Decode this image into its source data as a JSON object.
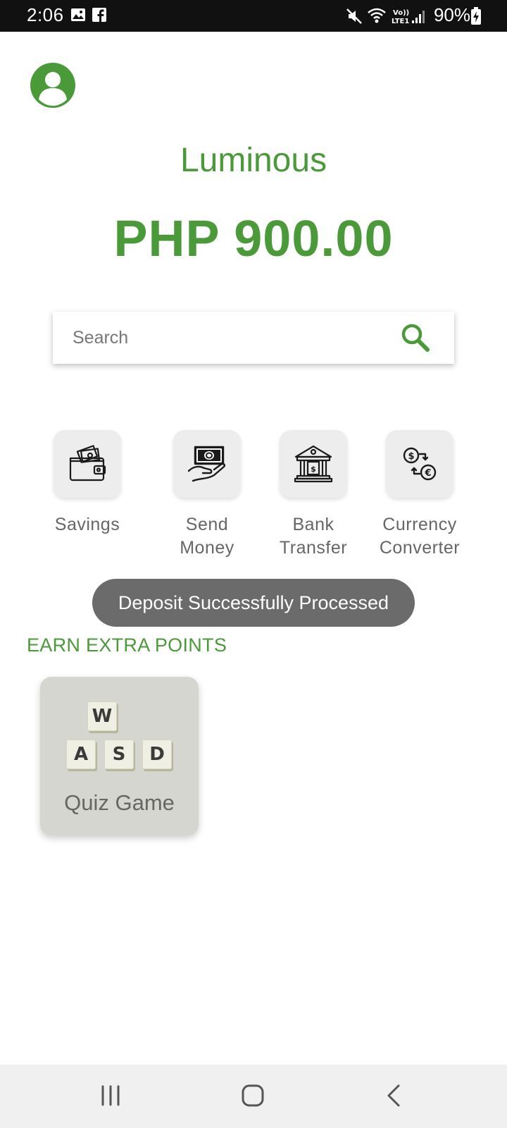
{
  "status_bar": {
    "time": "2:06",
    "battery": "90%",
    "icons": [
      "image-notification-icon",
      "facebook-icon",
      "mute-icon",
      "wifi-icon",
      "volte-icon",
      "signal-icon",
      "battery-charging-icon"
    ]
  },
  "header": {
    "app_name": "Luminous",
    "balance": "PHP 900.00"
  },
  "search": {
    "placeholder": "Search",
    "value": ""
  },
  "actions": [
    {
      "label": "Savings",
      "icon": "wallet-icon"
    },
    {
      "label": "Send\nMoney",
      "icon": "send-money-icon"
    },
    {
      "label": "Bank\nTransfer",
      "icon": "bank-icon"
    },
    {
      "label": "Currency\nConverter",
      "icon": "currency-exchange-icon"
    }
  ],
  "toast": {
    "message": "Deposit Successfully Processed"
  },
  "earn": {
    "section_title": "EARN EXTRA POINTS",
    "games": [
      {
        "title": "Quiz Game",
        "keys": [
          "W",
          "A",
          "S",
          "D"
        ]
      }
    ]
  },
  "colors": {
    "brand_green": "#4a9a3a",
    "toast_bg": "#6b6b6b",
    "status_bar_bg": "#111111"
  }
}
